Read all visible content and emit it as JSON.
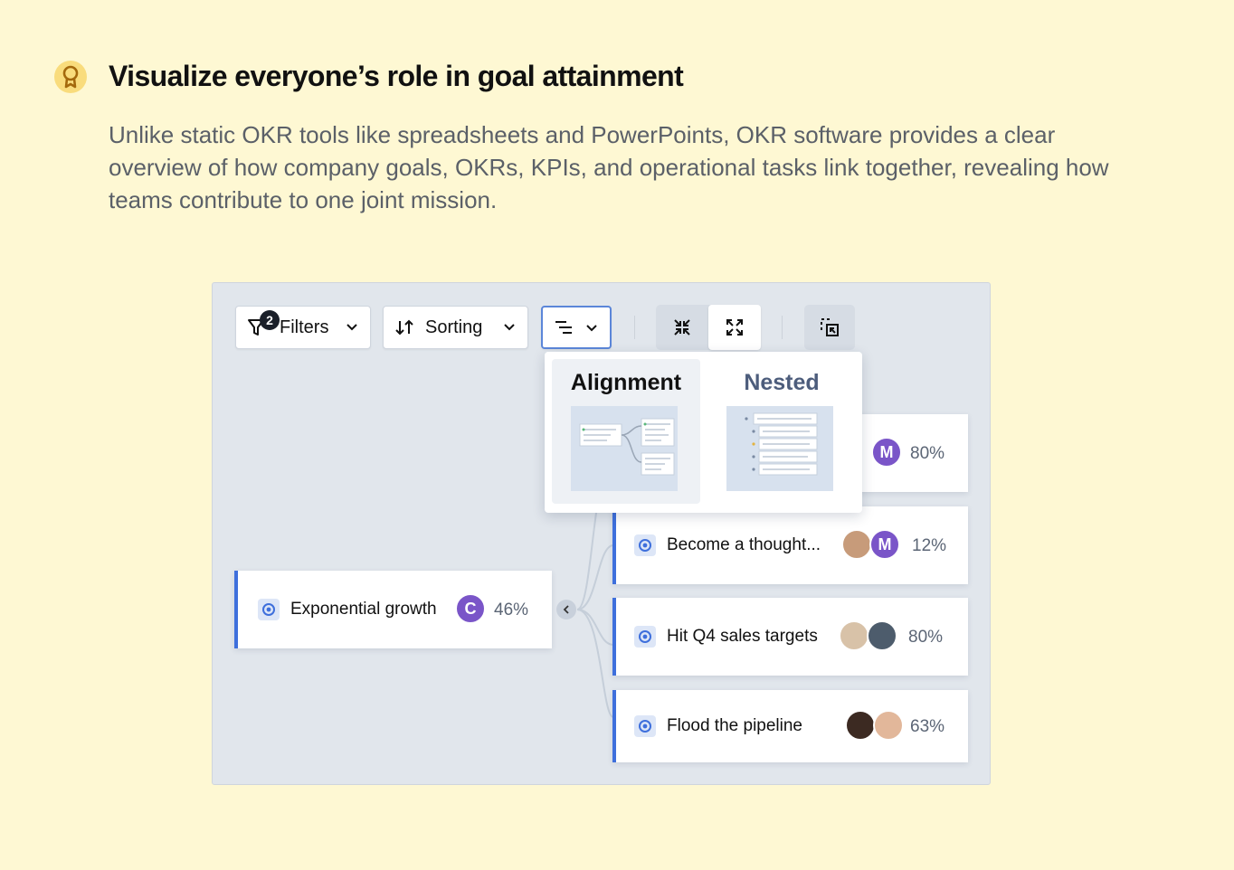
{
  "heading": "Visualize everyone’s role in goal attainment",
  "description": "Unlike static OKR tools like spreadsheets and PowerPoints, OKR software provides a clear overview of how company goals, OKRs, KPIs, and operational tasks link together, revealing how teams contribute to one joint mission.",
  "icons": {
    "heading": "award-ribbon-icon",
    "filter": "filter-icon",
    "sort": "sort-arrows-icon",
    "view": "tree-view-icon",
    "collapse": "collapse-arrows-icon",
    "expand": "expand-arrows-icon",
    "export": "export-icon",
    "goal": "goal-target-icon"
  },
  "toolbar": {
    "filters_label": "Filters",
    "filters_count": "2",
    "sorting_label": "Sorting"
  },
  "view_menu": {
    "options": [
      {
        "label": "Alignment",
        "selected": true
      },
      {
        "label": "Nested",
        "selected": false
      }
    ]
  },
  "tree": {
    "root": {
      "title": "Exponential growth",
      "avatar": "C",
      "progress": "46%"
    },
    "children": [
      {
        "title": "",
        "avatars": [
          "M"
        ],
        "progress": "80%"
      },
      {
        "title": "Become a thought...",
        "avatars": [
          "photo",
          "M"
        ],
        "progress": "12%"
      },
      {
        "title": "Hit Q4 sales targets",
        "avatars": [
          "photo",
          "photo"
        ],
        "progress": "80%"
      },
      {
        "title": "Flood the pipeline",
        "avatars": [
          "photo",
          "photo"
        ],
        "progress": "63%"
      }
    ]
  },
  "colors": {
    "page_background": "#fef8d3",
    "accent_blue": "#3e6fdc",
    "avatar_purple": "#7a55c8"
  }
}
